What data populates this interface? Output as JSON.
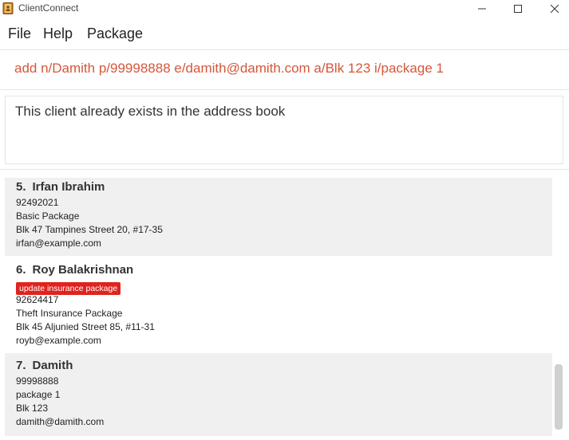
{
  "window": {
    "title": "ClientConnect",
    "icon": "address-book-icon",
    "controls": [
      "minimize-icon",
      "maximize-icon",
      "close-icon"
    ]
  },
  "menu": {
    "file": "File",
    "help": "Help",
    "package": "Package"
  },
  "command": {
    "value": "add n/Damith p/99998888 e/damith@damith.com a/Blk 123 i/package 1"
  },
  "result": {
    "message": "This client already exists in the address book"
  },
  "clients": [
    {
      "index": "5.",
      "name": "Irfan Ibrahim",
      "tag": "",
      "phone": "92492021",
      "package": "Basic Package",
      "address": "Blk 47 Tampines Street 20, #17-35",
      "email": "irfan@example.com"
    },
    {
      "index": "6.",
      "name": "Roy Balakrishnan",
      "tag": "update insurance package",
      "phone": "92624417",
      "package": "Theft Insurance Package",
      "address": "Blk 45 Aljunied Street 85, #11-31",
      "email": "royb@example.com"
    },
    {
      "index": "7.",
      "name": "Damith",
      "tag": "",
      "phone": "99998888",
      "package": "package 1",
      "address": "Blk 123",
      "email": "damith@damith.com"
    }
  ],
  "colors": {
    "command_text": "#d4573b",
    "tag_background": "#e0231d",
    "card_shaded": "#f0f0f0"
  }
}
